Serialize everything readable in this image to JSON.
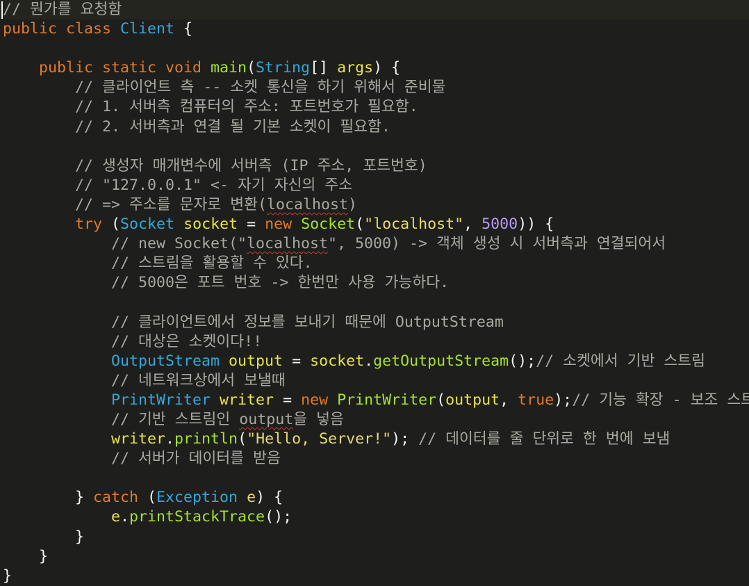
{
  "editor": {
    "language": "Java",
    "current_line": 0,
    "lines": [
      [
        {
          "t": "// 뭔가를 요청함",
          "c": "comment"
        }
      ],
      [
        {
          "t": "public class ",
          "c": "keyword"
        },
        {
          "t": "Client",
          "c": "type"
        },
        {
          "t": " {",
          "c": "plain"
        }
      ],
      [],
      [
        {
          "t": "    public static void ",
          "c": "keyword"
        },
        {
          "t": "main",
          "c": "method"
        },
        {
          "t": "(",
          "c": "plain"
        },
        {
          "t": "String",
          "c": "type"
        },
        {
          "t": "[] ",
          "c": "plain"
        },
        {
          "t": "args",
          "c": "var"
        },
        {
          "t": ") {",
          "c": "plain"
        }
      ],
      [
        {
          "t": "        // 클라이언트 측 -- 소켓 통신을 하기 위해서 준비물",
          "c": "comment"
        }
      ],
      [
        {
          "t": "        // 1. 서버측 컴퓨터의 주소: 포트번호가 필요함.",
          "c": "comment"
        }
      ],
      [
        {
          "t": "        // 2. 서버측과 연결 될 기본 소켓이 필요함.",
          "c": "comment"
        }
      ],
      [],
      [
        {
          "t": "        // 생성자 매개변수에 서버측 (IP 주소, 포트번호)",
          "c": "comment"
        }
      ],
      [
        {
          "t": "        // \"127.0.0.1\" <- 자기 자신의 주소",
          "c": "comment"
        }
      ],
      [
        {
          "t": "        // => 주소를 문자로 변환(",
          "c": "comment"
        },
        {
          "t": "localhost",
          "c": "comment",
          "squiggle": true
        },
        {
          "t": ")",
          "c": "comment"
        }
      ],
      [
        {
          "t": "        try ",
          "c": "keyword"
        },
        {
          "t": "(",
          "c": "plain"
        },
        {
          "t": "Socket",
          "c": "type"
        },
        {
          "t": " ",
          "c": "plain"
        },
        {
          "t": "socket",
          "c": "var"
        },
        {
          "t": " = ",
          "c": "plain"
        },
        {
          "t": "new ",
          "c": "keyword"
        },
        {
          "t": "Socket",
          "c": "method"
        },
        {
          "t": "(",
          "c": "plain"
        },
        {
          "t": "\"localhost\"",
          "c": "string"
        },
        {
          "t": ", ",
          "c": "plain"
        },
        {
          "t": "5000",
          "c": "number"
        },
        {
          "t": ")) {",
          "c": "plain"
        }
      ],
      [
        {
          "t": "            // new Socket(\"",
          "c": "comment"
        },
        {
          "t": "localhost",
          "c": "comment",
          "squiggle": true
        },
        {
          "t": "\", 5000) -> 객체 생성 시 서버측과 연결되어서",
          "c": "comment"
        }
      ],
      [
        {
          "t": "            // 스트림을 활용할 수 있다.",
          "c": "comment"
        }
      ],
      [
        {
          "t": "            // 5000은 포트 번호 -> 한번만 사용 가능하다.",
          "c": "comment"
        }
      ],
      [],
      [
        {
          "t": "            // 클라이언트에서 정보를 보내기 때문에 OutputStream",
          "c": "comment"
        }
      ],
      [
        {
          "t": "            // 대상은 소켓이다!!",
          "c": "comment"
        }
      ],
      [
        {
          "t": "            ",
          "c": "plain"
        },
        {
          "t": "OutputStream",
          "c": "type"
        },
        {
          "t": " ",
          "c": "plain"
        },
        {
          "t": "output",
          "c": "var"
        },
        {
          "t": " = ",
          "c": "plain"
        },
        {
          "t": "socket",
          "c": "var"
        },
        {
          "t": ".",
          "c": "plain"
        },
        {
          "t": "getOutputStream",
          "c": "method"
        },
        {
          "t": "();",
          "c": "plain"
        },
        {
          "t": "// 소켓에서 기반 스트림",
          "c": "comment"
        }
      ],
      [
        {
          "t": "            // 네트워크상에서 보낼때",
          "c": "comment"
        }
      ],
      [
        {
          "t": "            ",
          "c": "plain"
        },
        {
          "t": "PrintWriter",
          "c": "type"
        },
        {
          "t": " ",
          "c": "plain"
        },
        {
          "t": "writer",
          "c": "var"
        },
        {
          "t": " = ",
          "c": "plain"
        },
        {
          "t": "new ",
          "c": "keyword"
        },
        {
          "t": "PrintWriter",
          "c": "method"
        },
        {
          "t": "(",
          "c": "plain"
        },
        {
          "t": "output",
          "c": "var"
        },
        {
          "t": ", ",
          "c": "plain"
        },
        {
          "t": "true",
          "c": "keyword"
        },
        {
          "t": ");",
          "c": "plain"
        },
        {
          "t": "// 기능 확장 - 보조 스트림",
          "c": "comment"
        }
      ],
      [
        {
          "t": "            // 기반 스트림인 ",
          "c": "comment"
        },
        {
          "t": "output",
          "c": "comment",
          "squiggle": true
        },
        {
          "t": "을 넣음",
          "c": "comment"
        }
      ],
      [
        {
          "t": "            ",
          "c": "plain"
        },
        {
          "t": "writer",
          "c": "var"
        },
        {
          "t": ".",
          "c": "plain"
        },
        {
          "t": "println",
          "c": "method"
        },
        {
          "t": "(",
          "c": "plain"
        },
        {
          "t": "\"Hello, Server!\"",
          "c": "string"
        },
        {
          "t": "); ",
          "c": "plain"
        },
        {
          "t": "// 데이터를 줄 단위로 한 번에 보냄",
          "c": "comment"
        }
      ],
      [
        {
          "t": "            // 서버가 데이터를 받음",
          "c": "comment"
        }
      ],
      [],
      [
        {
          "t": "        } ",
          "c": "plain"
        },
        {
          "t": "catch ",
          "c": "keyword"
        },
        {
          "t": "(",
          "c": "plain"
        },
        {
          "t": "Exception",
          "c": "type"
        },
        {
          "t": " ",
          "c": "plain"
        },
        {
          "t": "e",
          "c": "var"
        },
        {
          "t": ") {",
          "c": "plain"
        }
      ],
      [
        {
          "t": "            ",
          "c": "plain"
        },
        {
          "t": "e",
          "c": "var"
        },
        {
          "t": ".",
          "c": "plain"
        },
        {
          "t": "printStackTrace",
          "c": "method"
        },
        {
          "t": "();",
          "c": "plain"
        }
      ],
      [
        {
          "t": "        }",
          "c": "plain"
        }
      ],
      [
        {
          "t": "    }",
          "c": "plain"
        }
      ],
      [
        {
          "t": "}",
          "c": "plain"
        }
      ]
    ]
  },
  "colors": {
    "background": "#1e1f1c",
    "comment": "#a7a9a0",
    "keyword": "#e07b2e",
    "type": "#36a6d8",
    "method": "#a6e22e",
    "variable": "#e6e24a",
    "string": "#e6db74",
    "number": "#b79af8",
    "plain": "#f8f8f2",
    "squiggle": "#c93a3a"
  }
}
